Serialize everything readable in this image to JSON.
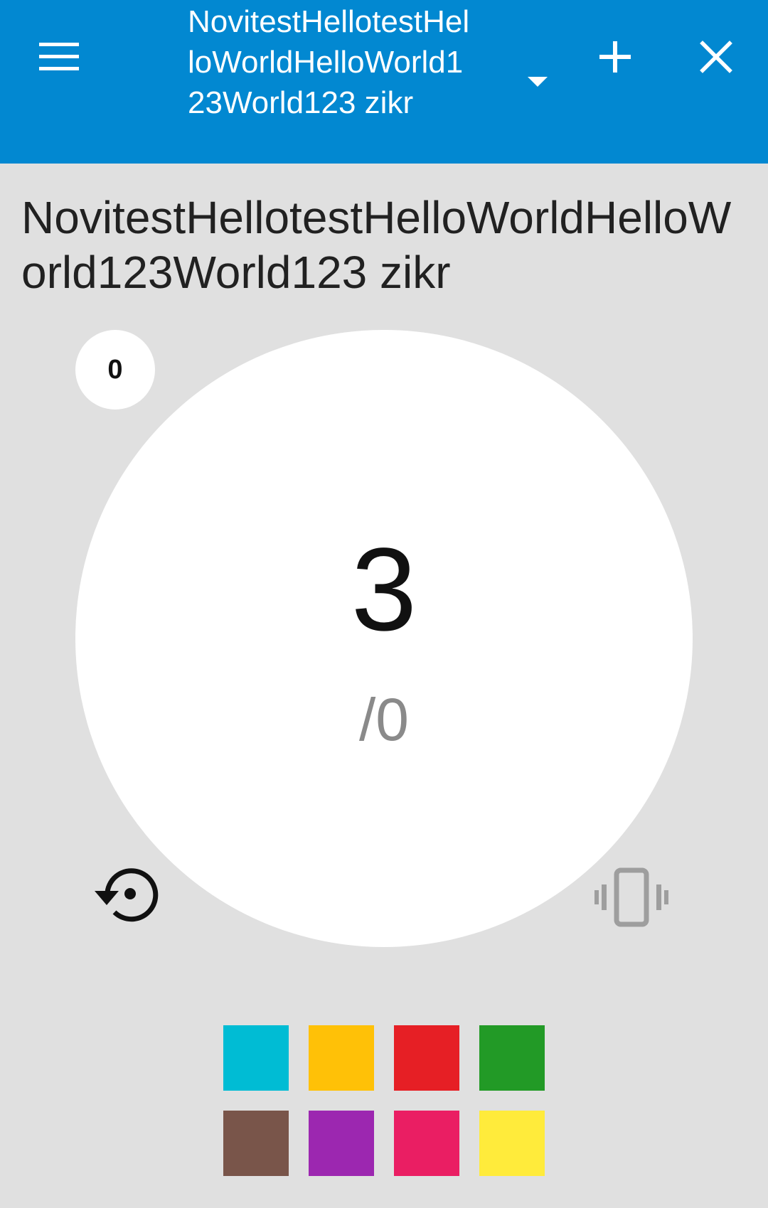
{
  "appbar": {
    "spinner_title": "NovitestHellotestHelloWorldHelloWorld123World123 zikr",
    "background_color": "#0288d1",
    "icons": {
      "menu": "menu-icon",
      "dropdown": "dropdown-arrow-icon",
      "add": "add-icon",
      "close": "close-icon"
    }
  },
  "main": {
    "zikr_title": "NovitestHellotestHelloWorldHelloWorld123World123 zikr",
    "round_count": "0",
    "count": "3",
    "target": "/0",
    "icons": {
      "reset": "reset-icon",
      "vibrate": "vibrate-icon"
    }
  },
  "palette": {
    "colors": [
      "#00bcd4",
      "#ffc107",
      "#e61f25",
      "#229a26",
      "#79554a",
      "#9c27b0",
      "#ea1e63",
      "#ffeb3b"
    ]
  }
}
